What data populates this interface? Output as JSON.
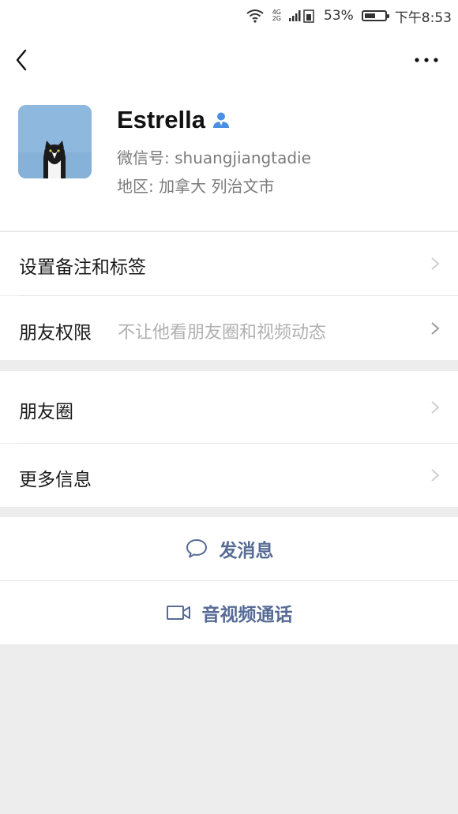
{
  "status_bar": {
    "network_top": "4G",
    "network_bottom": "2G",
    "battery_text": "53%",
    "battery_level": 0.53,
    "time": "下午8:53"
  },
  "nav": {
    "back_icon": "chevron-left-icon",
    "more_icon": "more-dots-icon"
  },
  "profile": {
    "name": "Estrella",
    "wechat_id_line": "微信号: shuangjiangtadie",
    "region_line": "地区: 加拿大  列治文市",
    "badge_icon": "person-icon",
    "badge_color": "#4a90e2"
  },
  "rows": {
    "remark": {
      "label": "设置备注和标签"
    },
    "permissions": {
      "label": "朋友权限",
      "value": "不让他看朋友圈和视频动态"
    },
    "moments": {
      "label": "朋友圈"
    },
    "more_info": {
      "label": "更多信息"
    }
  },
  "actions": {
    "message": {
      "label": "发消息",
      "icon": "chat-bubble-icon"
    },
    "call": {
      "label": "音视频通话",
      "icon": "video-camera-icon"
    }
  },
  "colors": {
    "link_blue": "#576b95",
    "background": "#ededed",
    "muted_text": "#7b7b7b"
  }
}
